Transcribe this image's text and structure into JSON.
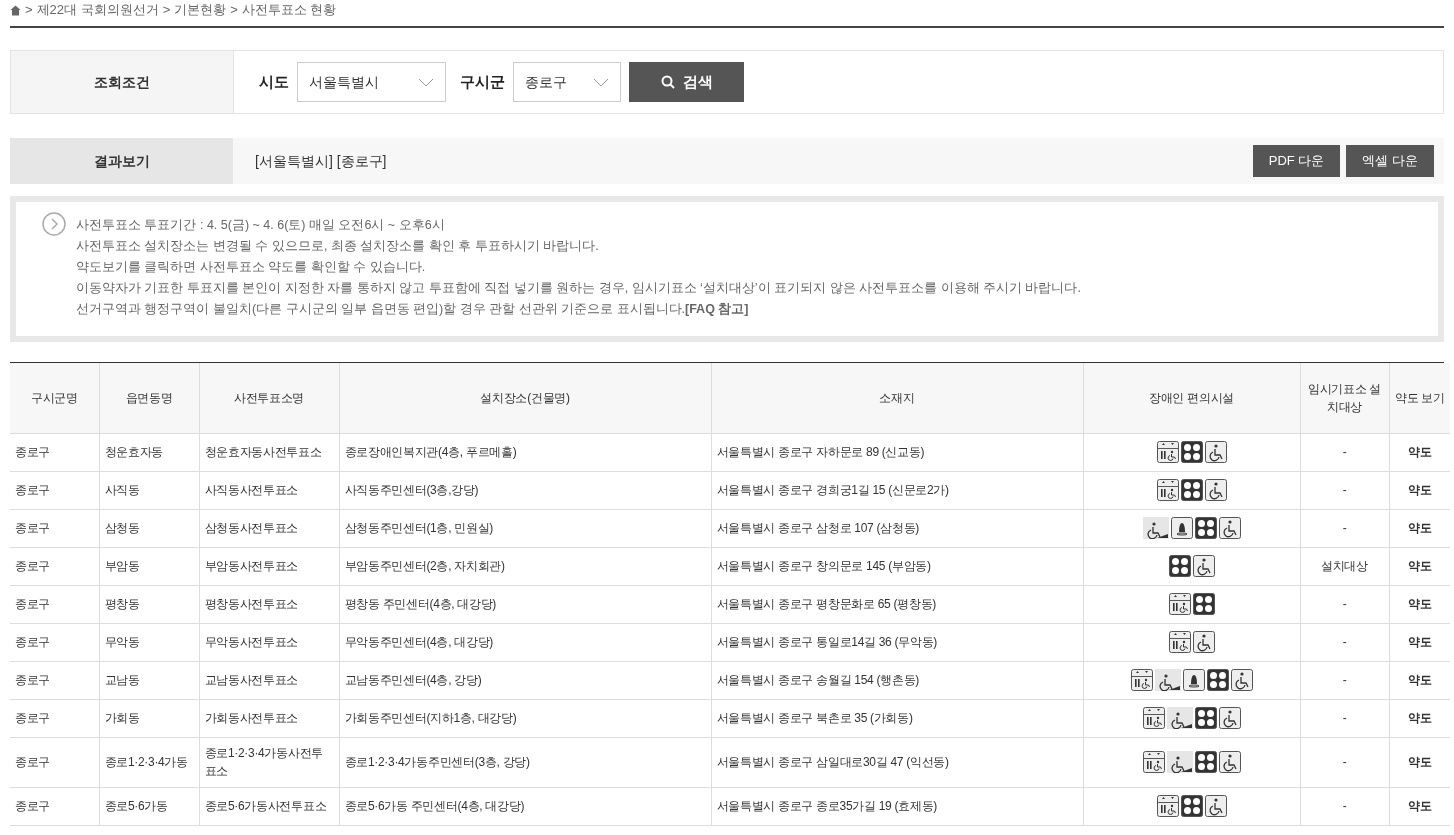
{
  "breadcrumb": [
    ">",
    "제22대 국회의원선거",
    ">",
    "기본현황",
    ">",
    "사전투표소 현황"
  ],
  "search": {
    "label": "조회조건",
    "fields": [
      {
        "label": "시도",
        "value": "서울특별시"
      },
      {
        "label": "구시군",
        "value": "종로구"
      }
    ],
    "button": "검색"
  },
  "result": {
    "label": "결과보기",
    "summary": "[서울특별시] [종로구]",
    "buttons": [
      "PDF 다운",
      "엑셀 다운"
    ]
  },
  "notice": [
    "사전투표소 투표기간 : 4. 5(금) ~ 4. 6(토) 매일 오전6시 ~ 오후6시",
    "사전투표소 설치장소는 변경될 수 있으므로, 최종 설치장소를 확인 후 투표하시기 바랍니다.",
    "약도보기를 클릭하면 사전투표소 약도를 확인할 수 있습니다.",
    "이동약자가 기표한 투표지를 본인이 지정한 자를 통하지 않고 투표함에 직접 넣기를 원하는 경우, 임시기표소 ‘설치대상’이 표기되지 않은 사전투표소를 이용해 주시기 바랍니다.",
    "선거구역과 행정구역이 불일치(다른 구시군의 일부 읍면동 편입)할 경우 관할 선관위 기준으로 표시됩니다.**[FAQ 참고]**"
  ],
  "table": {
    "columns": [
      "구시군명",
      "읍면동명",
      "사전투표소명",
      "설치장소(건물명)",
      "소재지",
      "장애인 편의시설",
      "임시기표소 설치대상",
      "약도 보기"
    ],
    "rows": [
      {
        "district": "종로구",
        "dong": "청운효자동",
        "station": "청운효자동사전투표소",
        "place": "종로장애인복지관(4층, 푸르메홀)",
        "address": "서울특별시 종로구 자하문로 89 (신교동)",
        "facilities": [
          {
            "kind": "elevator"
          },
          {
            "kind": "braille"
          },
          {
            "kind": "wheelchair"
          }
        ],
        "temp": "-",
        "map": "약도"
      },
      {
        "district": "종로구",
        "dong": "사직동",
        "station": "사직동사전투표소",
        "place": "사직동주민센터(3층,강당)",
        "address": "서울특별시 종로구 경희궁1길 15 (신문로2가)",
        "facilities": [
          {
            "kind": "elevator"
          },
          {
            "kind": "braille"
          },
          {
            "kind": "wheelchair"
          }
        ],
        "temp": "-",
        "map": "약도"
      },
      {
        "district": "종로구",
        "dong": "삼청동",
        "station": "삼청동사전투표소",
        "place": "삼청동주민센터(1층, 민원실)",
        "address": "서울특별시 종로구 삼청로 107 (삼청동)",
        "facilities": [
          {
            "kind": "ramp"
          },
          {
            "kind": "bell"
          },
          {
            "kind": "braille"
          },
          {
            "kind": "wheelchair"
          }
        ],
        "temp": "-",
        "map": "약도"
      },
      {
        "district": "종로구",
        "dong": "부암동",
        "station": "부암동사전투표소",
        "place": "부암동주민센터(2층, 자치회관)",
        "address": "서울특별시 종로구 창의문로 145 (부암동)",
        "facilities": [
          {
            "kind": "braille"
          },
          {
            "kind": "wheelchair"
          }
        ],
        "temp": "설치대상",
        "map": "약도"
      },
      {
        "district": "종로구",
        "dong": "평창동",
        "station": "평창동사전투표소",
        "place": "평창동 주민센터(4층, 대강당)",
        "address": "서울특별시 종로구 평창문화로 65 (평창동)",
        "facilities": [
          {
            "kind": "elevator"
          },
          {
            "kind": "braille"
          }
        ],
        "temp": "-",
        "map": "약도"
      },
      {
        "district": "종로구",
        "dong": "무악동",
        "station": "무악동사전투표소",
        "place": "무악동주민센터(4층, 대강당)",
        "address": "서울특별시 종로구 통일로14길 36 (무악동)",
        "facilities": [
          {
            "kind": "elevator"
          },
          {
            "kind": "wheelchair"
          }
        ],
        "temp": "-",
        "map": "약도"
      },
      {
        "district": "종로구",
        "dong": "교남동",
        "station": "교남동사전투표소",
        "place": "교남동주민센터(4층, 강당)",
        "address": "서울특별시 종로구 송월길 154 (행촌동)",
        "facilities": [
          {
            "kind": "elevator"
          },
          {
            "kind": "ramp"
          },
          {
            "kind": "bell"
          },
          {
            "kind": "braille"
          },
          {
            "kind": "wheelchair"
          }
        ],
        "temp": "-",
        "map": "약도"
      },
      {
        "district": "종로구",
        "dong": "가회동",
        "station": "가회동사전투표소",
        "place": "가회동주민센터(지하1층, 대강당)",
        "address": "서울특별시 종로구 북촌로 35 (가회동)",
        "facilities": [
          {
            "kind": "elevator"
          },
          {
            "kind": "ramp"
          },
          {
            "kind": "braille"
          },
          {
            "kind": "wheelchair"
          }
        ],
        "temp": "-",
        "map": "약도"
      },
      {
        "district": "종로구",
        "dong": "종로1·2·3·4가동",
        "station": "종로1·2·3·4가동사전투표소",
        "place": "종로1·2·3·4가동주민센터(3층, 강당)",
        "address": "서울특별시 종로구 삼일대로30길 47 (익선동)",
        "facilities": [
          {
            "kind": "elevator"
          },
          {
            "kind": "ramp"
          },
          {
            "kind": "braille"
          },
          {
            "kind": "wheelchair"
          }
        ],
        "temp": "-",
        "map": "약도"
      },
      {
        "district": "종로구",
        "dong": "종로5·6가동",
        "station": "종로5·6가동사전투표소",
        "place": "종로5·6가동 주민센터(4층, 대강당)",
        "address": "서울특별시 종로구 종로35가길 19 (효제동)",
        "facilities": [
          {
            "kind": "elevator"
          },
          {
            "kind": "braille"
          },
          {
            "kind": "wheelchair"
          }
        ],
        "temp": "-",
        "map": "약도"
      }
    ]
  }
}
